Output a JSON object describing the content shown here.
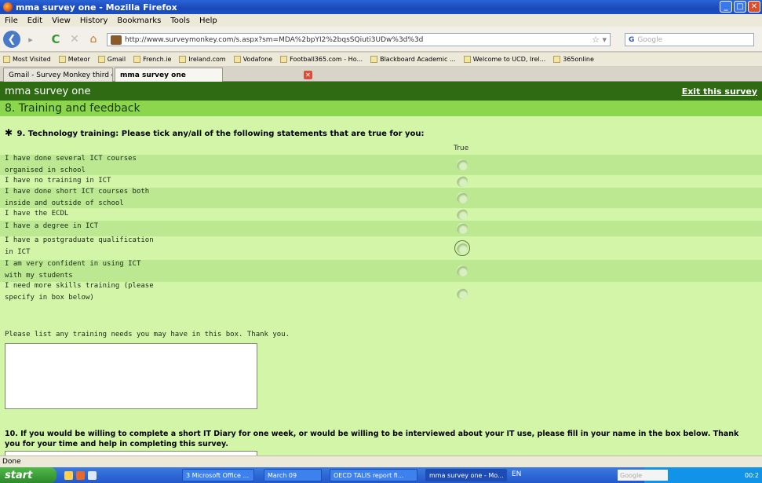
{
  "window": {
    "title": "mma survey one - Mozilla Firefox"
  },
  "menu": [
    "File",
    "Edit",
    "View",
    "History",
    "Bookmarks",
    "Tools",
    "Help"
  ],
  "nav": {
    "url": "http://www.surveymonkey.com/s.aspx?sm=MDA%2bpYI2%2bqsSQiuti3UDw%3d%3d",
    "search_placeholder": "Google"
  },
  "bookmarks": [
    "Most Visited",
    "Meteor",
    "Gmail",
    "French.ie",
    "Ireland.com",
    "Vodafone",
    "Football365.com - Ho...",
    "Blackboard Academic ...",
    "Welcome to UCD, Irel...",
    "365online"
  ],
  "tabs": [
    "Gmail - Survey Monkey third collector - ...",
    "mma survey one"
  ],
  "survey": {
    "title": "mma survey one",
    "exit_label": "Exit this survey",
    "section": "8. Training and feedback",
    "q9": {
      "asterisk": "✱",
      "text": "9. Technology training: Please tick any/all of the following statements that are true for you:",
      "column": "True",
      "options": [
        {
          "line1": "I have done several ICT courses",
          "line2": "organised in school"
        },
        {
          "line1": "I have no training in ICT",
          "line2": ""
        },
        {
          "line1": "I have done short ICT courses both",
          "line2": "inside and outside of school"
        },
        {
          "line1": "I have the ECDL",
          "line2": ""
        },
        {
          "line1": "I have a degree in ICT",
          "line2": ""
        },
        {
          "line1": "I have a postgraduate qualification",
          "line2": "in ICT"
        },
        {
          "line1": "I am very confident in using ICT",
          "line2": "with my students"
        },
        {
          "line1": "I need more skills training (please",
          "line2": "specify in box below)"
        }
      ],
      "comment_label": "Please list any training needs you may have in this box. Thank you."
    },
    "q10": {
      "text": "10. If you would be willing to complete a short IT Diary for one week, or would be willing to be interviewed about your IT use, please fill in your name in the box below. Thank you for your time and help in completing this survey."
    }
  },
  "status": "Done",
  "taskbar": {
    "start": "start",
    "items": [
      "3 Microsoft Office ...",
      "March 09",
      "OECD TALIS report fi...",
      "mma survey one - Mo..."
    ],
    "lang": "EN",
    "search": "Google",
    "clock": "00:2"
  }
}
